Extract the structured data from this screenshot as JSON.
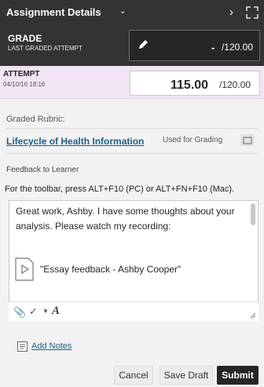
{
  "header": {
    "title": "Assignment Details",
    "caret_icon": "chevron-down-icon",
    "next_icon": "chevron-right-icon",
    "expand_icon": "expand-icon"
  },
  "grade": {
    "label": "GRADE",
    "sublabel": "LAST GRADED ATTEMPT",
    "value": "-",
    "max": "/120.00"
  },
  "attempt": {
    "label": "ATTEMPT",
    "date": "04/10/16 18:16",
    "score": "115.00",
    "max": "/120.00"
  },
  "rubric": {
    "heading": "Graded Rubric:",
    "link": "Lifecycle of Health Information",
    "status": "Used for Grading"
  },
  "feedback": {
    "heading": "Feedback to Learner",
    "toolbar_hint": "For the toolbar, press ALT+F10 (PC) or ALT+FN+F10 (Mac).",
    "text": "Great work, Ashby. I have some thoughts about your analysis. Please watch my recording:",
    "media_label": "\"Essay feedback - Ashby Cooper\""
  },
  "add_notes": "Add Notes",
  "buttons": {
    "cancel": "Cancel",
    "save_draft": "Save Draft",
    "submit": "Submit"
  },
  "colors": {
    "header_bg": "#333333",
    "attempt_bg": "#f1e4f4",
    "link": "#1b5f8a",
    "submit_bg": "#262626"
  }
}
